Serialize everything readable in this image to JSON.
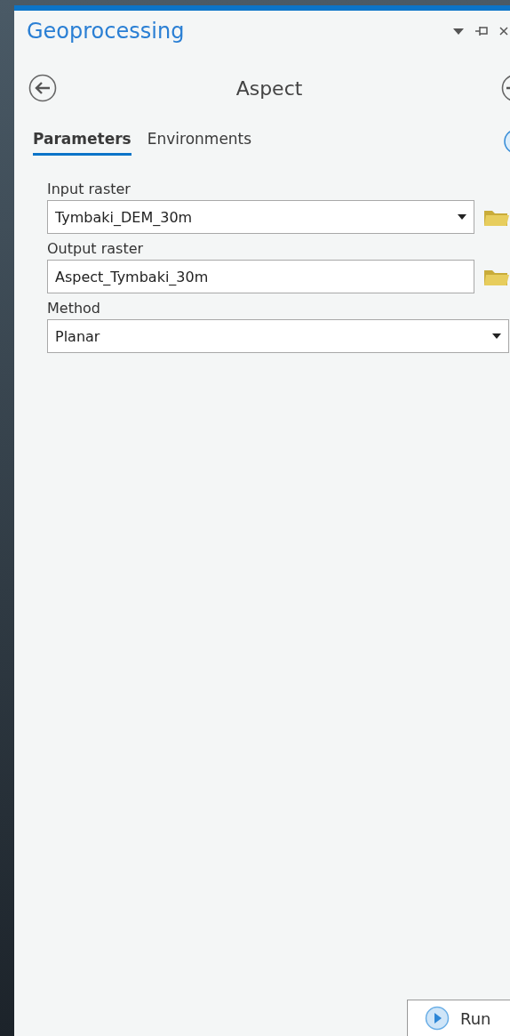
{
  "pane": {
    "title": "Geoprocessing"
  },
  "tool": {
    "title": "Aspect"
  },
  "tabs": [
    {
      "label": "Parameters",
      "selected": true
    },
    {
      "label": "Environments",
      "selected": false
    }
  ],
  "parameters": [
    {
      "label": "Input raster",
      "value": "Tymbaki_DEM_30m",
      "kind": "dropdown",
      "browse": true
    },
    {
      "label": "Output raster",
      "value": "Aspect_Tymbaki_30m",
      "kind": "text",
      "browse": true
    },
    {
      "label": "Method",
      "value": "Planar",
      "kind": "dropdown",
      "browse": false
    }
  ],
  "run_button": {
    "label": "Run"
  }
}
